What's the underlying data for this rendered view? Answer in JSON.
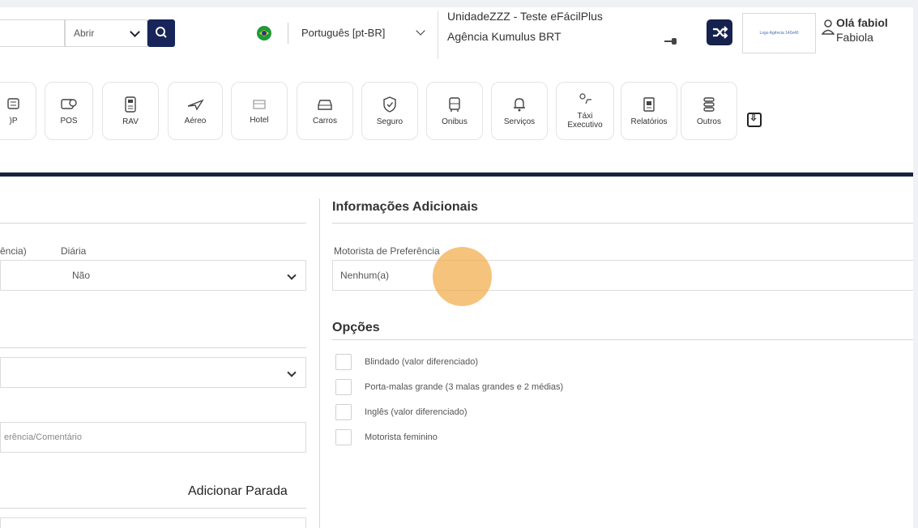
{
  "topbar": {
    "open_select": {
      "value": "Abrir"
    },
    "language": "Português [pt-BR]",
    "unit": "UnidadeZZZ - Teste eFácilPlus",
    "agency": "Agência Kumulus BRT",
    "logo_text": "Logo Agência 140x40",
    "greeting": "Olá fabiol",
    "username": "Fabiola"
  },
  "modules": [
    {
      "id": "op",
      "label": ")P",
      "icon": "op-icon"
    },
    {
      "id": "pos",
      "label": "POS",
      "icon": "pos-icon"
    },
    {
      "id": "rav",
      "label": "RAV",
      "icon": "rav-icon"
    },
    {
      "id": "aereo",
      "label": "Aéreo",
      "icon": "plane-icon"
    },
    {
      "id": "hotel",
      "label": "Hotel",
      "icon": "hotel-icon"
    },
    {
      "id": "carros",
      "label": "Carros",
      "icon": "car-icon"
    },
    {
      "id": "seguro",
      "label": "Seguro",
      "icon": "shield-icon"
    },
    {
      "id": "onibus",
      "label": "Onibus",
      "icon": "bus-icon"
    },
    {
      "id": "servicos",
      "label": "Serviços",
      "icon": "bell-icon"
    },
    {
      "id": "taxi",
      "label": "Táxi Executivo",
      "icon": "taxi-icon"
    },
    {
      "id": "relatorios",
      "label": "Relatórios",
      "icon": "report-icon"
    },
    {
      "id": "outros",
      "label": "Outros",
      "icon": "stack-icon"
    }
  ],
  "left": {
    "pref_label": "ência)",
    "diaria_label": "Diária",
    "diaria_value": "Não",
    "comment_placeholder": "erência/Comentário",
    "add_stop": "Adicionar Parada"
  },
  "right": {
    "additional_title": "Informações Adicionais",
    "driver_label": "Motorista de Preferência",
    "driver_value": "Nenhum(a)",
    "options_title": "Opções",
    "options": [
      "Blindado (valor diferenciado)",
      "Porta-malas grande (3 malas grandes e 2 médias)",
      "Inglês (valor diferenciado)",
      "Motorista feminino"
    ]
  },
  "colors": {
    "navy": "#17233f",
    "accent_orange": "#f1aa45",
    "button_dark": "#16224d"
  }
}
